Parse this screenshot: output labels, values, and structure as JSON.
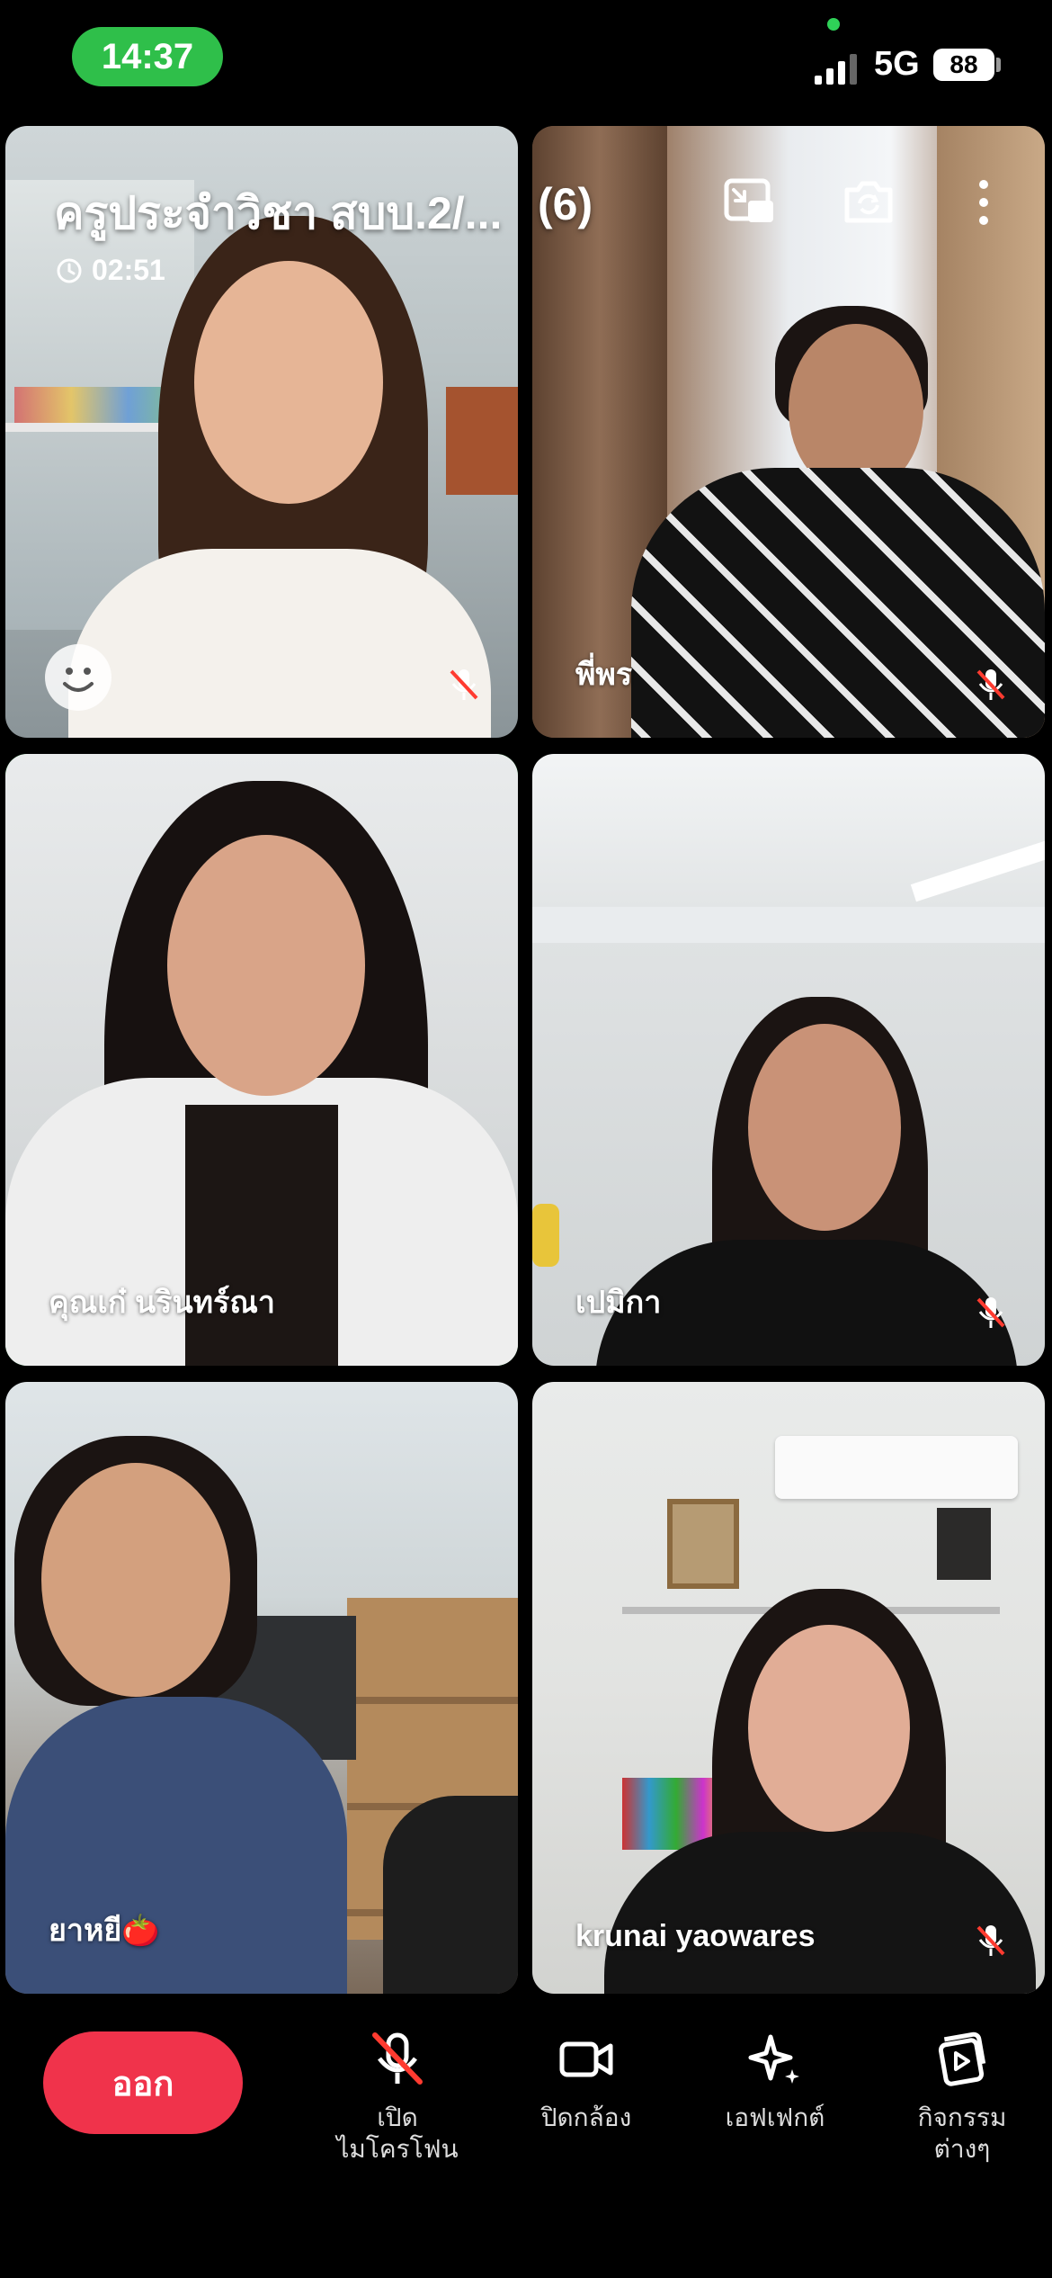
{
  "status_bar": {
    "time": "14:37",
    "network": "5G",
    "battery": "88"
  },
  "call": {
    "title": "ครูประจำวิชา สบบ.2/...",
    "participant_count": "(6)",
    "duration": "02:51"
  },
  "participants": [
    {
      "name": "",
      "muted": true
    },
    {
      "name": "พี่พร",
      "muted": true
    },
    {
      "name": "คุณเก๋ นรินทร์ณา",
      "muted": false,
      "active_speaker": true
    },
    {
      "name": "เปมิกา",
      "muted": true
    },
    {
      "name": "ยาหยี🍅",
      "muted": false
    },
    {
      "name": "krunai yaowares",
      "muted": true
    }
  ],
  "controls": {
    "leave": "ออก",
    "mic": "เปิด\nไมโครโฟน",
    "camera": "ปิดกล้อง",
    "effects": "เอฟเฟกต์",
    "activities": "กิจกรรม\nต่างๆ"
  },
  "colors": {
    "accent_green": "#2fbf4a",
    "leave_red": "#f0334b",
    "mute_red": "#ff3b30"
  }
}
